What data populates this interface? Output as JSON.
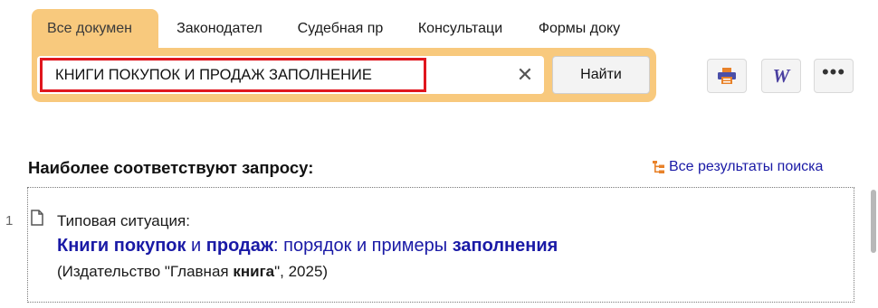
{
  "tabs": [
    {
      "label": "Все докумен",
      "active": true
    },
    {
      "label": "Законодател",
      "active": false
    },
    {
      "label": "Судебная пр",
      "active": false
    },
    {
      "label": "Консультаци",
      "active": false
    },
    {
      "label": "Формы доку",
      "active": false
    }
  ],
  "search": {
    "value": "КНИГИ ПОКУПОК И ПРОДАЖ ЗАПОЛНЕНИЕ",
    "clear_glyph": "✕",
    "button_label": "Найти"
  },
  "toolbar": {
    "print_icon": "printer-icon",
    "word_icon": "word-export-icon",
    "word_glyph": "W",
    "more_icon": "more-icon",
    "more_glyph": "•••"
  },
  "results": {
    "heading": "Наиболее соответствуют запросу:",
    "all_results_label": "Все результаты поиска",
    "items": [
      {
        "number": "1",
        "type": "Типовая ситуация:",
        "title_parts": [
          "Книги покупок",
          " и ",
          "продаж",
          ": порядок и примеры ",
          "заполнения"
        ],
        "source_parts": [
          "(Издательство \"Главная ",
          "книга",
          "\", 2025)"
        ]
      }
    ]
  },
  "colors": {
    "accent": "#f8c97d",
    "highlight_border": "#e0161e",
    "link": "#1a1aa6",
    "icon_orange": "#e8822a"
  }
}
